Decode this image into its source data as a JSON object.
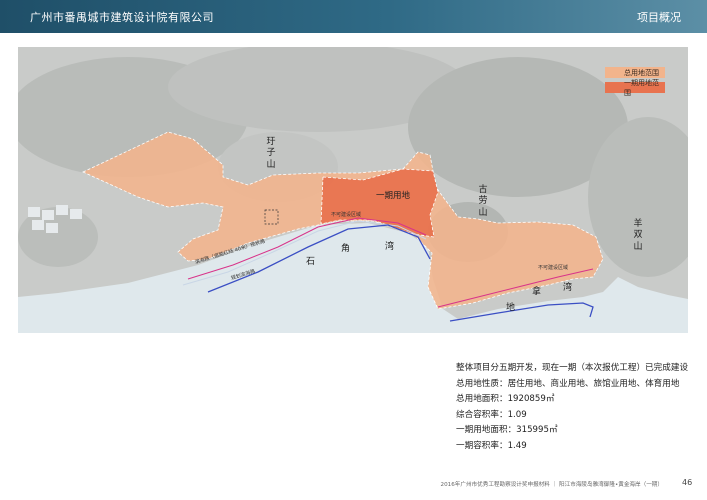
{
  "header": {
    "company": "广州市番禺城市建筑设计院有限公司",
    "section": "项目概况"
  },
  "map": {
    "legend": [
      {
        "label": "总用地范围",
        "color": "#f2b48c"
      },
      {
        "label": "一期用地范围",
        "color": "#e8734f"
      }
    ],
    "labels": {
      "hill_yuzi": "玗子山",
      "hill_gulao": "古劳山",
      "hill_yangshuang": "羊双山",
      "phase_one": "一期用地",
      "bay_shi": "石",
      "bay_jiao": "角",
      "bay_wan": "湾",
      "bay_di": "地",
      "bay_na": "拿",
      "bay_wan2": "湾",
      "no_build_1": "不可建设区域",
      "no_build_2": "不可建设区域",
      "road_1": "滨海路（道路红线 40米）现状路",
      "road_2": "规划滨海路"
    }
  },
  "info": {
    "line1": "整体项目分五期开发，现在一期（本次报优工程）已完成建设",
    "line2": "总用地性质：居住用地、商业用地、旅馆业用地、体育用地",
    "line3": "总用地面积：1920859㎡",
    "line4": "综合容积率：1.09",
    "line5": "一期用地面积：315995㎡",
    "line6": "一期容积率：1.49"
  },
  "footer": {
    "text": "2016年广州市优秀工程勘察设计奖申报材料 ｜ 阳江市海陵岛雅湾御隆•黄金海岸（一期）",
    "page": "46"
  }
}
